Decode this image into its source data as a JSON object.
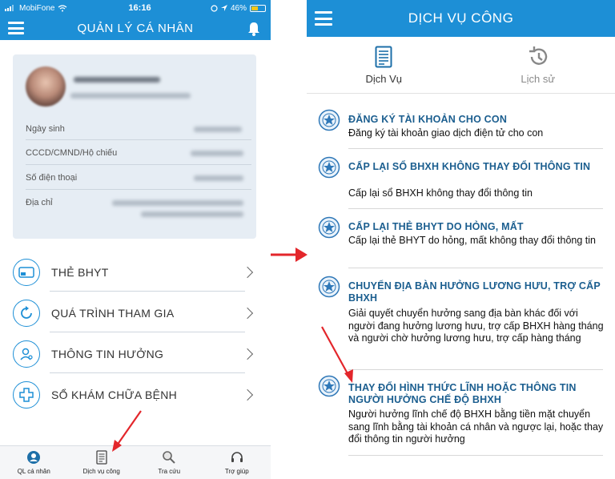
{
  "left_screen": {
    "status": {
      "carrier": "MobiFone",
      "time": "16:16",
      "battery": "46%"
    },
    "title": "QUẢN LÝ CÁ NHÂN",
    "profile_rows": [
      {
        "label": "Ngày sinh"
      },
      {
        "label": "CCCD/CMND/Hộ chiếu"
      },
      {
        "label": "Số điện thoại"
      },
      {
        "label": "Địa chỉ"
      }
    ],
    "menu": [
      {
        "label": "THẺ BHYT",
        "icon": "health-card-icon"
      },
      {
        "label": "QUÁ TRÌNH THAM GIA",
        "icon": "refresh-icon"
      },
      {
        "label": "THÔNG TIN HƯỞNG",
        "icon": "user-icon"
      },
      {
        "label": "SỔ KHÁM CHỮA BỆNH",
        "icon": "medical-cross-icon"
      }
    ],
    "bottom_nav": [
      {
        "label": "QL cá nhân",
        "icon": "profile-badge-icon"
      },
      {
        "label": "Dịch vụ công",
        "icon": "document-icon"
      },
      {
        "label": "Tra cứu",
        "icon": "search-icon"
      },
      {
        "label": "Trợ giúp",
        "icon": "headset-icon"
      }
    ]
  },
  "right_screen": {
    "title": "DỊCH VỤ CÔNG",
    "tabs": [
      {
        "label": "Dịch Vụ",
        "icon": "document-icon",
        "active": true
      },
      {
        "label": "Lịch sử",
        "icon": "history-icon",
        "active": false
      }
    ],
    "services": [
      {
        "title": "ĐĂNG KÝ TÀI KHOẢN CHO CON",
        "desc": "Đăng ký tài khoản giao dịch điện tử cho con"
      },
      {
        "title": "CẤP LẠI SỔ BHXH KHÔNG THAY ĐỔI THÔNG TIN",
        "desc": "Cấp lại sổ BHXH không thay đổi thông tin"
      },
      {
        "title": "CẤP LẠI THẺ BHYT DO HỎNG, MẤT",
        "desc": "Cấp lại thẻ BHYT do hỏng, mất không thay đổi thông tin"
      },
      {
        "title": "CHUYỂN ĐỊA BÀN HƯỞNG LƯƠNG HƯU, TRỢ CẤP BHXH",
        "desc": "Giải quyết chuyển hưởng sang địa bàn khác đối với người đang hưởng lương hưu, trợ cấp BHXH hàng tháng và người chờ hưởng lương hưu, trợ cấp hàng tháng"
      },
      {
        "title": "THAY ĐỔI HÌNH THỨC LĨNH HOẶC THÔNG TIN NGƯỜI HƯỞNG CHẾ ĐỘ BHXH",
        "desc": "Người hưởng lĩnh chế độ BHXH bằng tiền mặt chuyển sang lĩnh bằng tài khoản cá nhân và ngược lại, hoặc thay đổi thông tin người hưởng"
      }
    ]
  },
  "colors": {
    "primary": "#1d8fd6",
    "annotation": "#e3262b",
    "service_title": "#1b5e8f"
  }
}
